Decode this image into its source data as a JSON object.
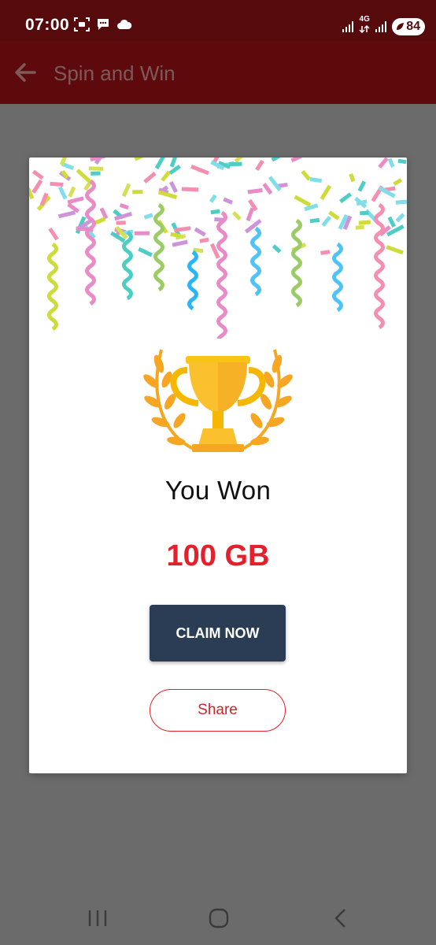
{
  "status_bar": {
    "time": "07:00",
    "network_label": "4G",
    "battery": "84",
    "icons": [
      "screenshot-icon",
      "chat-bubble-icon",
      "cloud-icon",
      "signal-icon",
      "network-4g-icon",
      "signal-icon",
      "battery-icon"
    ]
  },
  "app_bar": {
    "title": "Spin and Win",
    "back_icon": "arrow-left-icon"
  },
  "dialog": {
    "won_text": "You Won",
    "prize": "100 GB",
    "claim_label": "CLAIM NOW",
    "share_label": "Share",
    "illustration": "trophy-with-laurel",
    "decoration": "confetti-streamers"
  },
  "nav_bar": {
    "icons": [
      "recent-apps-icon",
      "home-icon",
      "back-icon"
    ]
  },
  "colors": {
    "status_bar": "#570a0c",
    "app_bar": "#5e090b",
    "overlay": "#6b6b6b",
    "accent_red": "#e3202b",
    "claim_button": "#2a3d55"
  }
}
